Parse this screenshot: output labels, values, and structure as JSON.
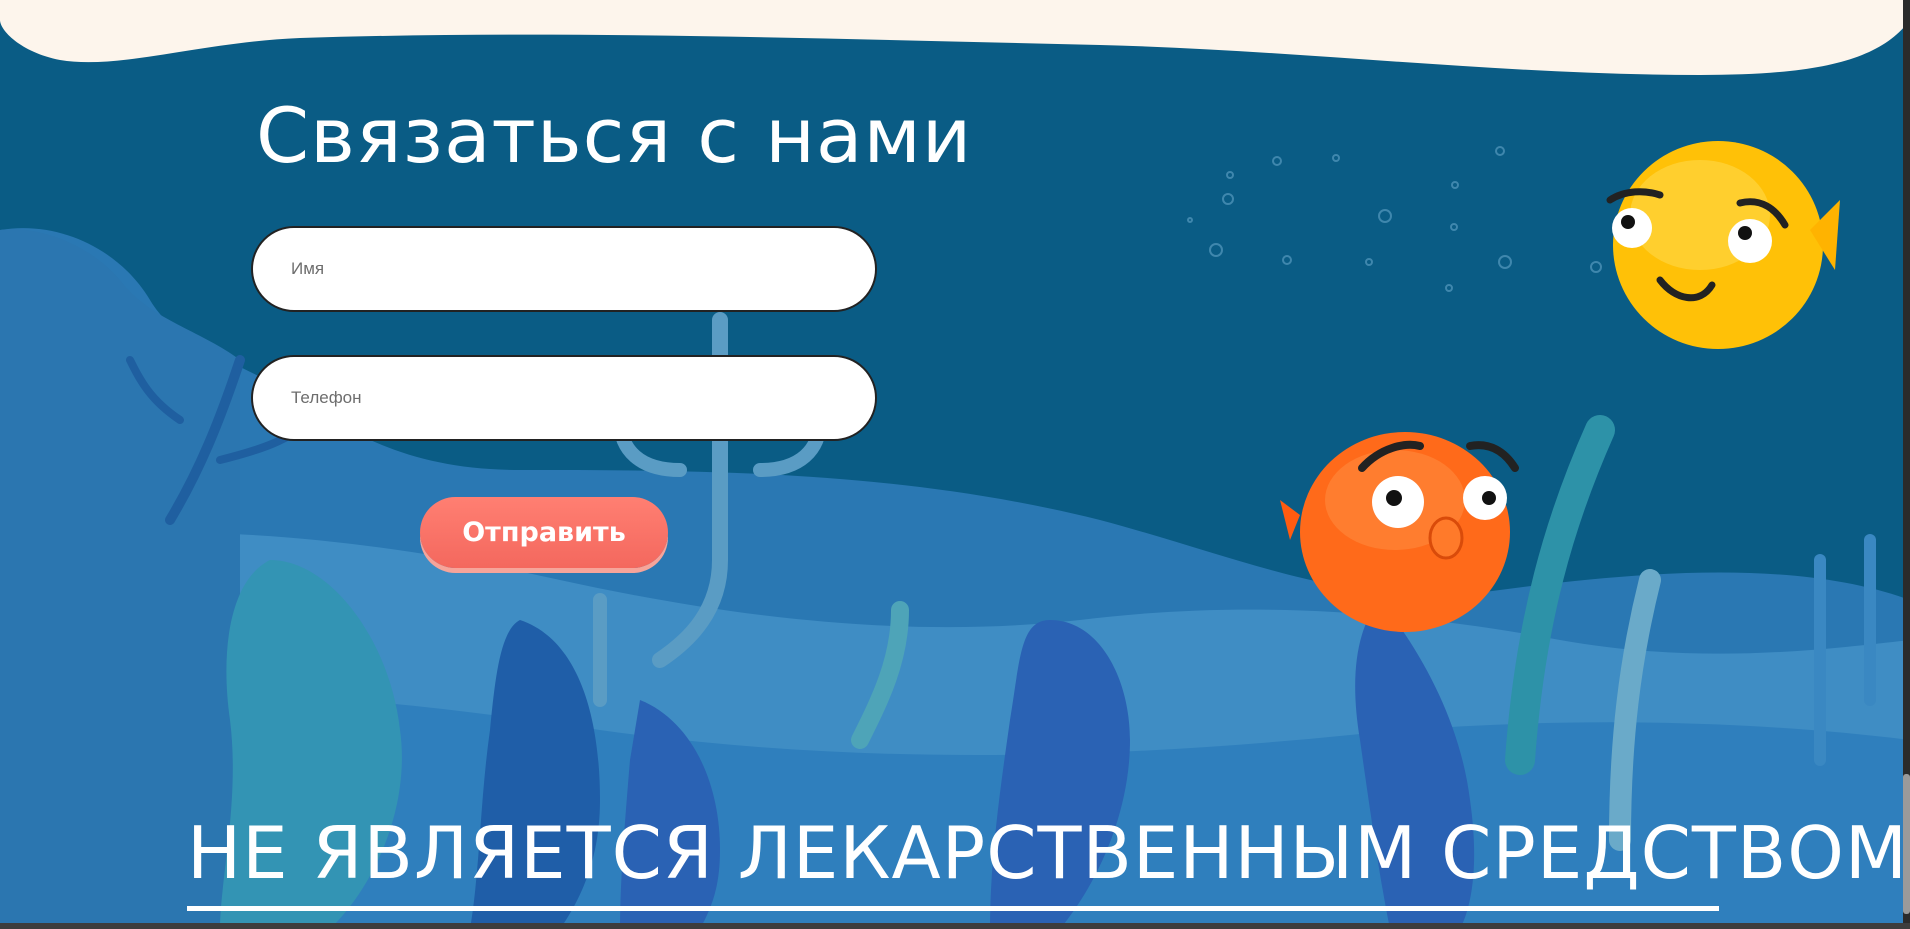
{
  "contact": {
    "title": "Связаться с нами",
    "name_placeholder": "Имя",
    "phone_placeholder": "Телефон",
    "submit_label": "Отправить"
  },
  "footer": {
    "disclaimer": "НЕ ЯВЛЯЕТСЯ ЛЕКАРСТВЕННЫМ СРЕДСТВОМ"
  },
  "colors": {
    "ocean": "#0a5c85",
    "sand_top": "#fdf5ec",
    "button": "#f4685e",
    "yellow_fish": "#ffc400",
    "orange_fish": "#ff6a1a"
  },
  "icons": [
    "yellow-pufferfish-illustration",
    "orange-pufferfish-illustration",
    "seaweed-decor",
    "bubbles-decor"
  ]
}
